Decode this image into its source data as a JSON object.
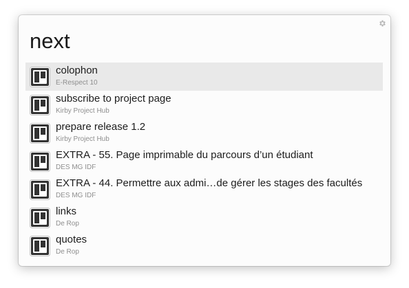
{
  "search": {
    "query": "next"
  },
  "settings_icon": "gear-icon",
  "results": [
    {
      "title": "colophon",
      "subtitle": "E-Respect 10",
      "icon": "board-icon",
      "selected": true
    },
    {
      "title": "subscribe to project page",
      "subtitle": "Kirby Project Hub",
      "icon": "board-icon",
      "selected": false
    },
    {
      "title": "prepare release 1.2",
      "subtitle": "Kirby Project Hub",
      "icon": "board-icon",
      "selected": false
    },
    {
      "title": "EXTRA - 55. Page imprimable du parcours d’un étudiant",
      "subtitle": "DES MG IDF",
      "icon": "board-icon",
      "selected": false
    },
    {
      "title": "EXTRA - 44. Permettre aux admi…de gérer les stages des facultés",
      "subtitle": "DES MG IDF",
      "icon": "board-icon",
      "selected": false
    },
    {
      "title": "links",
      "subtitle": "De Rop",
      "icon": "board-icon",
      "selected": false
    },
    {
      "title": "quotes",
      "subtitle": "De Rop",
      "icon": "board-icon",
      "selected": false
    }
  ],
  "colors": {
    "selected_row": "#e9e9e9",
    "icon_dark": "#333333",
    "subtitle": "#8e8e8e"
  }
}
